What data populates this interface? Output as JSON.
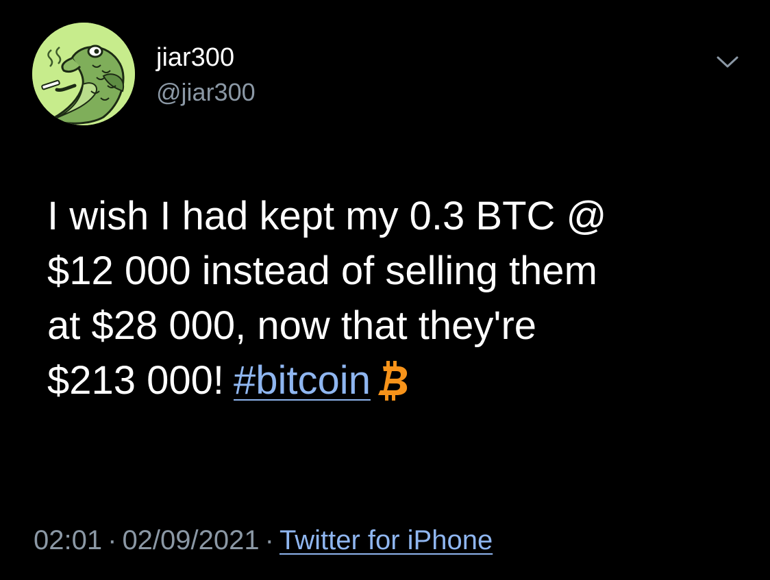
{
  "author": {
    "display_name": "jiar300",
    "handle": "@jiar300",
    "avatar_icon": "fish-smoking-avatar-icon"
  },
  "tweet": {
    "lines": [
      "I wish I had kept my 0.3 BTC @",
      "$12 000 instead of selling them",
      "at $28 000, now that they're",
      "$213 000!"
    ],
    "hashtag": "#bitcoin",
    "emoji_icon": "bitcoin-icon"
  },
  "meta": {
    "time": "02:01",
    "separator": "·",
    "date": "02/09/2021",
    "source": "Twitter for iPhone"
  },
  "controls": {
    "more_icon": "chevron-down-icon"
  },
  "colors": {
    "background": "#000000",
    "text": "#ffffff",
    "secondary_text": "#8b98a5",
    "link": "#8fb6f0",
    "bitcoin": "#f7931a",
    "avatar_background": "#c7ec8c"
  }
}
